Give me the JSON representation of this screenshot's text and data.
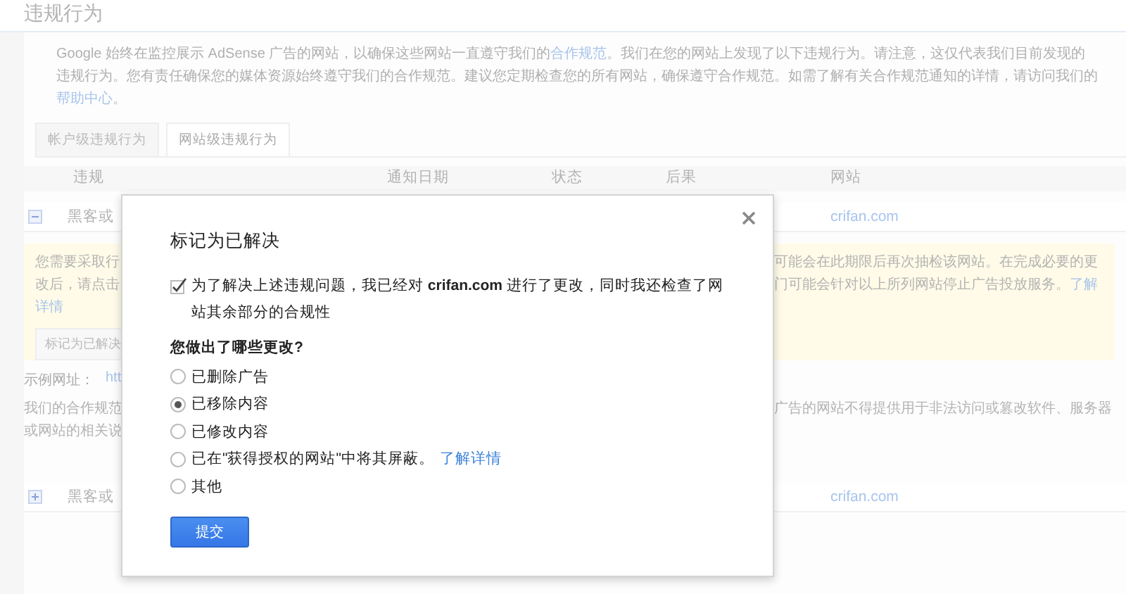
{
  "page_title": "违规行为",
  "intro": [
    {
      "kind": "text",
      "text": "Google 始终在监控展示 AdSense 广告的网站，以确保这些网站一直遵守我们的"
    },
    {
      "kind": "link",
      "text": "合作规范"
    },
    {
      "kind": "text",
      "text": "。我们在您的网站上发现了以下违规行为。请注意，这仅代表我们目前发现的违规行为。您有责任确保您的媒体资源始终遵守我们的合作规范。建议您定期检查您的所有网站，确保遵守合作规范。如需了解有关合作规范通知的详情，请访问我们的"
    },
    {
      "kind": "link",
      "text": "帮助中心"
    },
    {
      "kind": "text",
      "text": "。"
    }
  ],
  "tabs": [
    {
      "label": "帐户级违规行为",
      "selected": false
    },
    {
      "label": "网站级违规行为",
      "selected": true
    }
  ],
  "table": {
    "columns": [
      "违规",
      "通知日期",
      "状态",
      "后果",
      "网站"
    ],
    "rows": [
      {
        "expanded": true,
        "violation": "黑客或",
        "site": "crifan.com"
      },
      {
        "expanded": false,
        "violation": "黑客或",
        "site": "crifan.com"
      }
    ]
  },
  "details": {
    "notice_left": [
      "您需要采取行",
      "改后，请点击"
    ],
    "notice_left_link": "详情",
    "notice_right": [
      "可能会在此期限后再次抽检该网站。在完成必要的更",
      "门可能会针对以上所列网站停止广告投放服务。"
    ],
    "notice_right_link": "了解",
    "resolve_button": "标记为已解决",
    "example_label": "示例网址：",
    "example_link": "htt",
    "policy_left": [
      "我们的合作规范",
      "或网站的相关说"
    ],
    "policy_right": [
      "广告的网站不得提供用于非法访问或篡改软件、服务器"
    ]
  },
  "dialog": {
    "title": "标记为已解决",
    "confirm": {
      "checked": true,
      "text": "为了解决上述违规问题，我已经对 **crifan.com** 进行了更改，同时我还检查了网站其余部分的合规性"
    },
    "question": "您做出了哪些更改?",
    "options": [
      {
        "label": "已删除广告",
        "selected": false
      },
      {
        "label": "已移除内容",
        "selected": true
      },
      {
        "label": "已修改内容",
        "selected": false
      },
      {
        "label": "已在\"获得授权的网站\"中将其屏蔽。",
        "link": "了解详情",
        "selected": false
      },
      {
        "label": "其他",
        "selected": false
      }
    ],
    "submit": "提交"
  }
}
